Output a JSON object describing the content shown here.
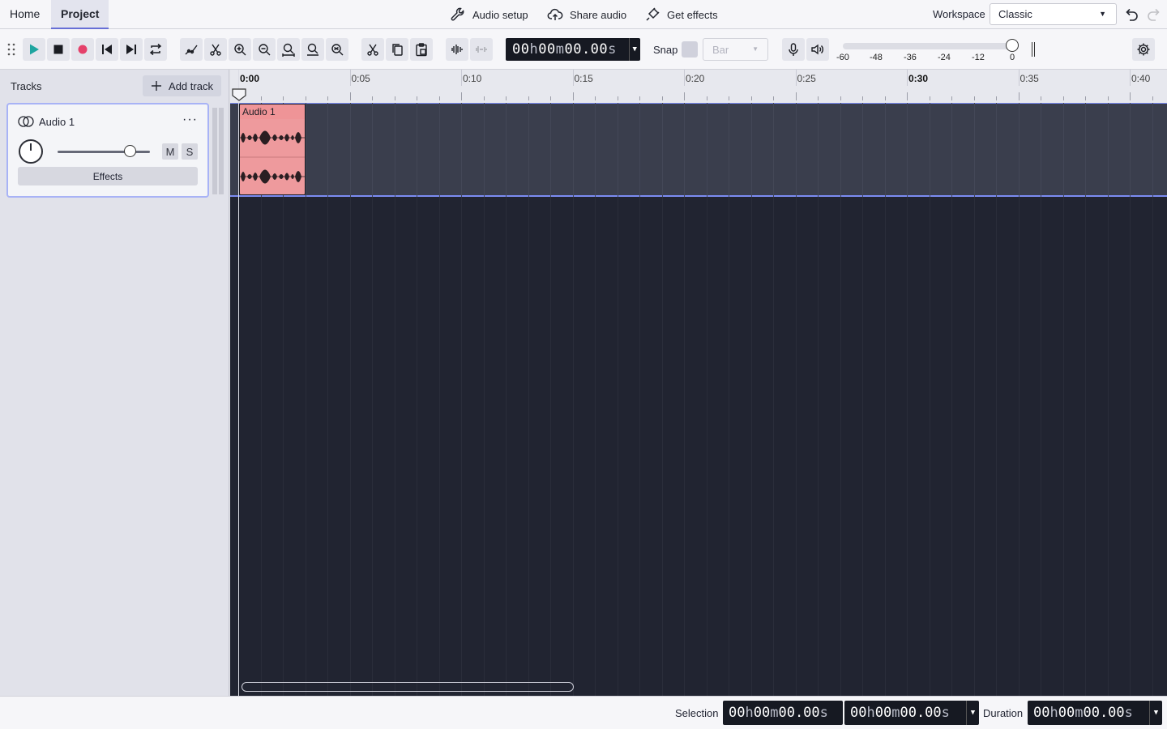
{
  "tabs": [
    {
      "label": "Home",
      "active": false
    },
    {
      "label": "Project",
      "active": true
    }
  ],
  "menu": {
    "audio_setup": "Audio setup",
    "share_audio": "Share audio",
    "get_effects": "Get effects"
  },
  "workspace": {
    "label": "Workspace",
    "value": "Classic"
  },
  "toolbar": {
    "time": {
      "h": "00",
      "m": "00",
      "s": "00.00"
    },
    "snap_label": "Snap",
    "snap_value": "Bar",
    "meter_ticks": [
      "-60",
      "-48",
      "-36",
      "-24",
      "-12",
      "0"
    ],
    "icons": [
      "play-icon",
      "stop-icon",
      "record-icon",
      "skip-start-icon",
      "skip-end-icon",
      "loop-icon",
      "automation-icon",
      "multi-tool-icon",
      "zoom-in-icon",
      "zoom-out-icon",
      "fit-selection-icon",
      "fit-project-icon",
      "zoom-toggle-icon",
      "cut-icon",
      "copy-icon",
      "paste-icon",
      "trim-icon",
      "silence-icon",
      "microphone-icon",
      "speaker-icon",
      "gear-icon"
    ]
  },
  "tracks_panel": {
    "header": "Tracks",
    "add_track": "Add track",
    "tracks": [
      {
        "name": "Audio 1",
        "mute": "M",
        "solo": "S",
        "effects": "Effects",
        "menu": "···"
      }
    ]
  },
  "timeline": {
    "ruler_labels": [
      "0:00",
      "0:05",
      "0:10",
      "0:15",
      "0:20",
      "0:25",
      "0:30",
      "0:35",
      "0:40"
    ],
    "bold_labels": [
      "0:00",
      "0:30"
    ],
    "clip": {
      "name": "Audio 1"
    }
  },
  "bottombar": {
    "selection_label": "Selection",
    "duration_label": "Duration",
    "selection_start": {
      "h": "00",
      "m": "00",
      "s": "00.00"
    },
    "selection_end": {
      "h": "00",
      "m": "00",
      "s": "00.00"
    },
    "duration": {
      "h": "00",
      "m": "00",
      "s": "00.00"
    }
  },
  "colors": {
    "accent": "#676fd6",
    "record": "#e5416a",
    "play": "#1fa5a0",
    "clip": "#ee9a9d",
    "timeline_bg": "#212431"
  }
}
